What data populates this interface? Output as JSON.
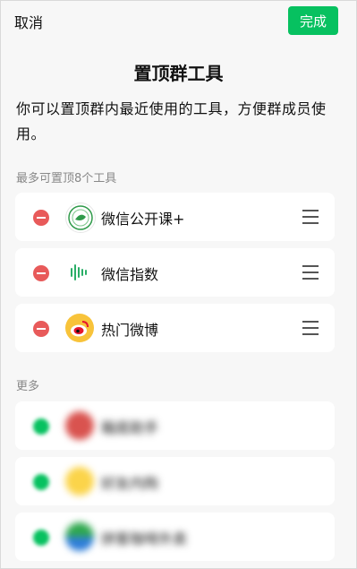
{
  "header": {
    "cancel_label": "取消",
    "done_label": "完成"
  },
  "title": "置顶群工具",
  "description": "你可以置顶群内最近使用的工具，方便群成员使用。",
  "pinned_section_label": "最多可置顶8个工具",
  "pinned": [
    {
      "name": "微信公开课+",
      "icon": "wechat-open-class-icon"
    },
    {
      "name": "微信指数",
      "icon": "wechat-index-icon"
    },
    {
      "name": "热门微博",
      "icon": "weibo-icon"
    }
  ],
  "more_section_label": "更多",
  "more": [
    {
      "name": "箱底助手",
      "icon": "red-circle-app-icon"
    },
    {
      "name": "好友内购",
      "icon": "yellow-bag-app-icon"
    },
    {
      "name": "拼客咖啡外卖",
      "icon": "green-blue-app-icon"
    }
  ],
  "colors": {
    "accent": "#07c160",
    "remove": "#e85a5a",
    "background": "#f7f7f7"
  }
}
